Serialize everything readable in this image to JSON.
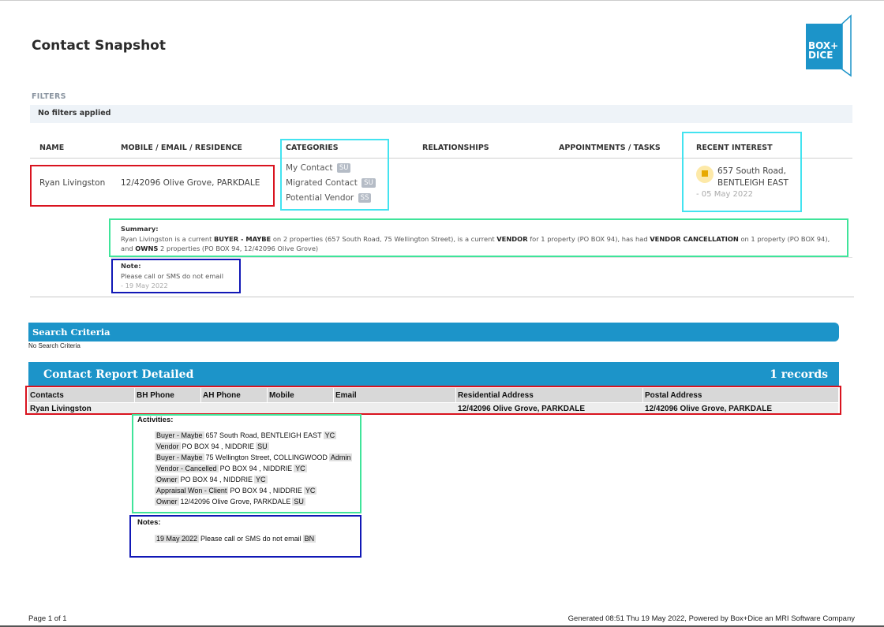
{
  "report": {
    "title": "Contact Snapshot",
    "logo_lines": [
      "BOX+",
      "DICE"
    ],
    "brand_color": "#1c94c9"
  },
  "filters": {
    "label": "FILTERS",
    "value": "No filters applied"
  },
  "columns": {
    "name": "NAME",
    "contact": "MOBILE / EMAIL / RESIDENCE",
    "categories": "CATEGORIES",
    "relationships": "RELATIONSHIPS",
    "appointments": "APPOINTMENTS / TASKS",
    "recent_interest": "RECENT INTEREST"
  },
  "contact": {
    "name": "Ryan Livingston",
    "residence": "12/42096 Olive Grove, PARKDALE",
    "categories": [
      {
        "label": "My Contact",
        "badge": "SU"
      },
      {
        "label": "Migrated Contact",
        "badge": "SU"
      },
      {
        "label": "Potential Vendor",
        "badge": "SS"
      }
    ],
    "recent_interest": {
      "line1": "657 South Road,",
      "line2": "BENTLEIGH EAST",
      "date": "- 05 May 2022",
      "icon": "flag-icon"
    },
    "summary": {
      "label": "Summary:",
      "p1": "Ryan Livingston is a current ",
      "b1": "BUYER - MAYBE",
      "p2": " on 2 properties (657 South Road, 75 Wellington Street), is a current ",
      "b2": "VENDOR",
      "p3": " for 1 property (PO BOX 94), has had ",
      "b3": "VENDOR CANCELLATION",
      "p4": " on 1 property (PO BOX 94),",
      "p5": "and ",
      "b4": "OWNS",
      "p6": " 2 properties (PO BOX 94, 12/42096 Olive Grove)"
    },
    "note": {
      "label": "Note:",
      "text": "Please call or SMS do not email",
      "date": "- 19 May 2022"
    }
  },
  "search_criteria": {
    "title": "Search Criteria",
    "value": "No Search Criteria"
  },
  "detailed": {
    "title": "Contact Report Detailed",
    "records": "1 records",
    "headers": [
      "Contacts",
      "BH Phone",
      "AH Phone",
      "Mobile",
      "Email",
      "Residential Address",
      "Postal Address"
    ],
    "row": [
      "Ryan Livingston",
      "",
      "",
      "",
      "",
      "12/42096 Olive Grove, PARKDALE",
      "12/42096 Olive Grove, PARKDALE"
    ],
    "activities_label": "Activities:",
    "activities": [
      {
        "role": "Buyer - Maybe",
        "text": "657 South Road, BENTLEIGH EAST",
        "by": "YC"
      },
      {
        "role": "Vendor",
        "text": "PO BOX 94 , NIDDRIE",
        "by": "SU"
      },
      {
        "role": "Buyer - Maybe",
        "text": "75 Wellington Street, COLLINGWOOD",
        "by": "Admin"
      },
      {
        "role": "Vendor - Cancelled",
        "text": "PO BOX 94 , NIDDRIE",
        "by": "YC"
      },
      {
        "role": "Owner",
        "text": "PO BOX 94 , NIDDRIE",
        "by": "YC"
      },
      {
        "role": "Appraisal Won - Client",
        "text": "PO BOX 94 , NIDDRIE",
        "by": "YC"
      },
      {
        "role": "Owner",
        "text": "12/42096 Olive Grove, PARKDALE",
        "by": "SU"
      }
    ],
    "notes_label": "Notes:",
    "notes": [
      {
        "date": "19 May 2022",
        "text": "Please call or SMS do not email",
        "by": "BN"
      }
    ]
  },
  "footer": {
    "page": "Page 1 of 1",
    "generated": "Generated 08:51 Thu 19 May 2022, Powered by Box+Dice an MRI Software Company"
  }
}
